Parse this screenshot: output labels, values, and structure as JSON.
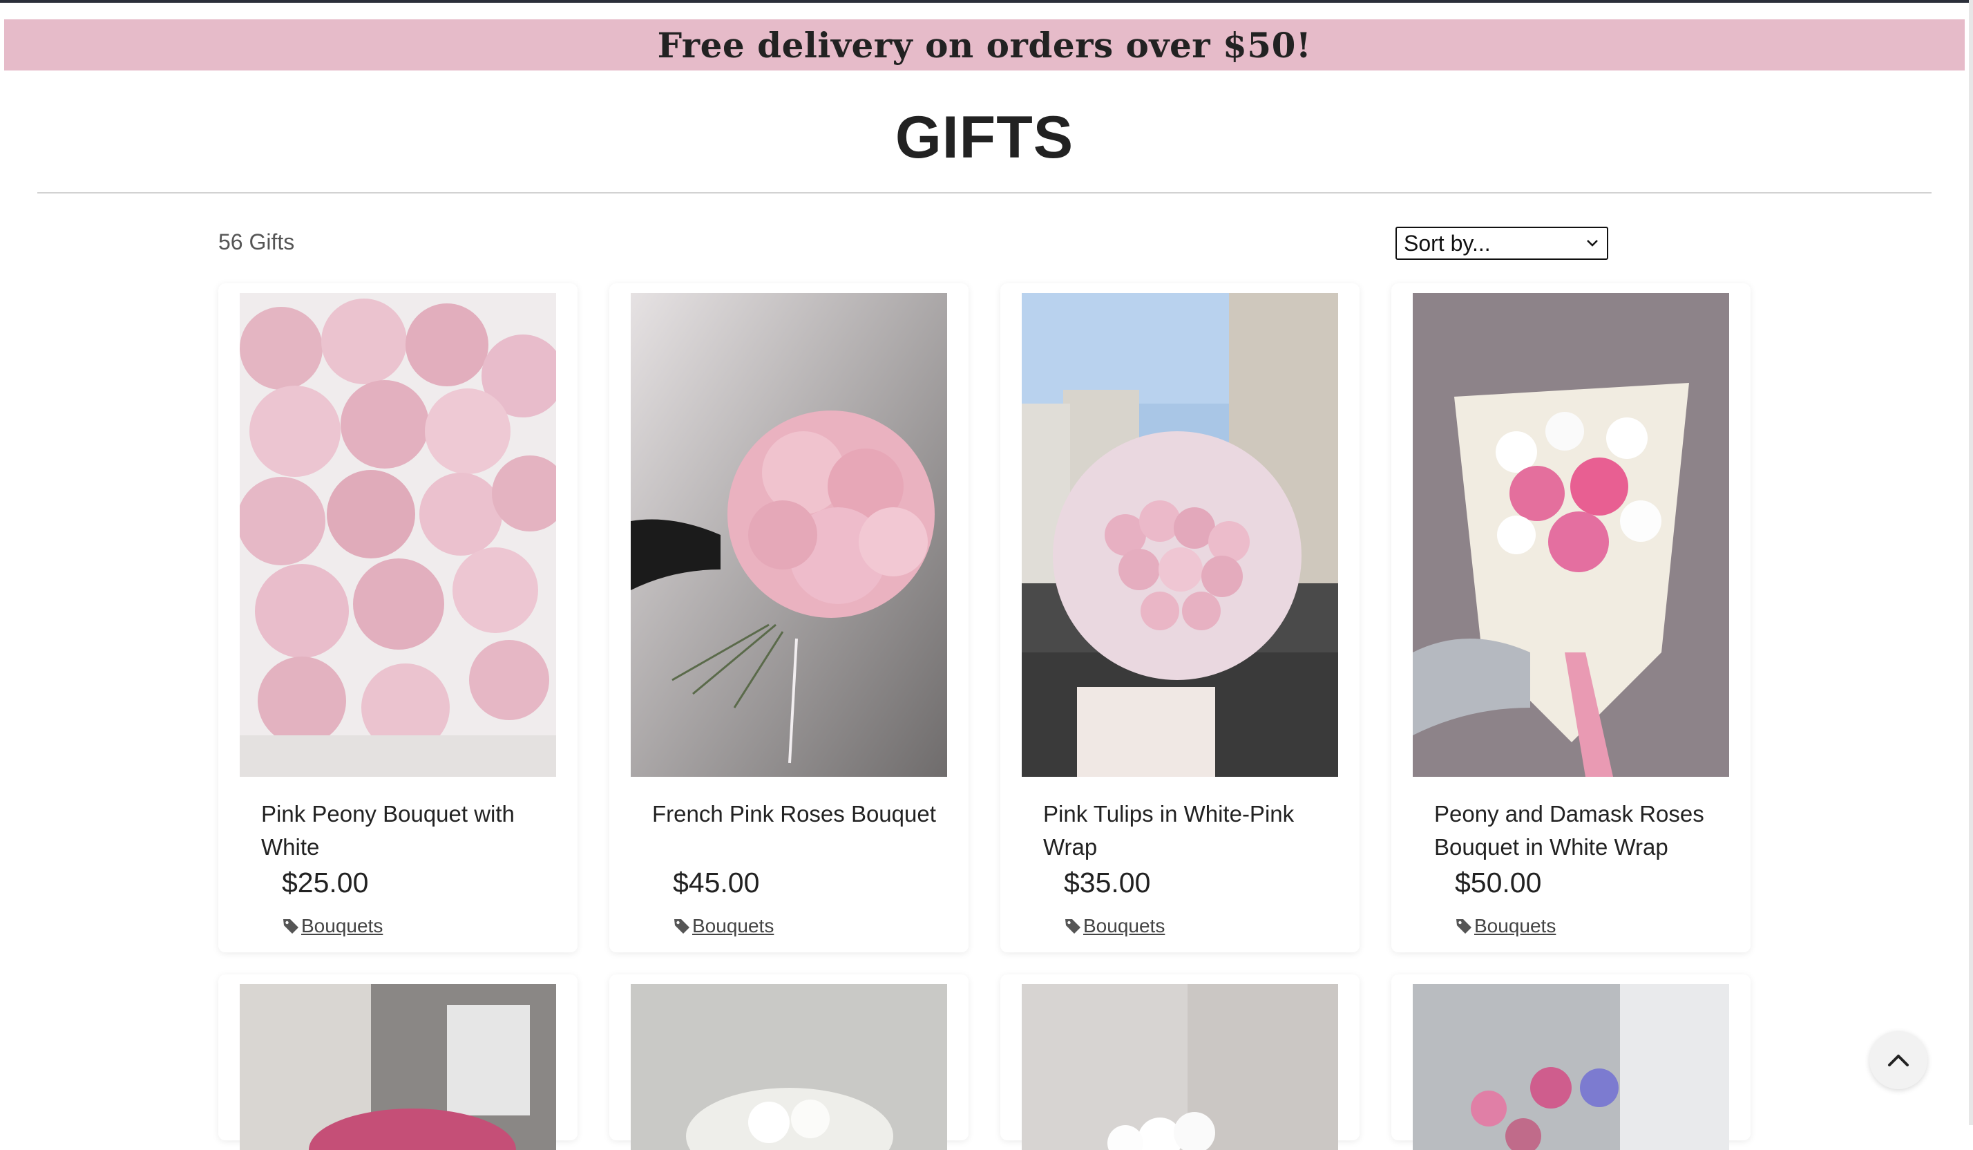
{
  "banner": {
    "text": "Free delivery on orders over $50!"
  },
  "page": {
    "title": "GIFTS",
    "count": "56 Gifts"
  },
  "sort": {
    "label": "Sort by..."
  },
  "products": [
    {
      "name": "Pink Peony Bouquet with White",
      "price": "$25.00",
      "category": "Bouquets"
    },
    {
      "name": "French Pink Roses Bouquet",
      "price": "$45.00",
      "category": "Bouquets"
    },
    {
      "name": "Pink Tulips in White-Pink Wrap",
      "price": "$35.00",
      "category": "Bouquets"
    },
    {
      "name": "Peony and Damask Roses Bouquet in White Wrap",
      "price": "$50.00",
      "category": "Bouquets"
    }
  ],
  "icons": {
    "tag": "tag-icon",
    "sort_chevron": "chevron-down-icon",
    "back_to_top": "chevron-up-icon"
  },
  "colors": {
    "banner": "#e6bbc9",
    "text": "#222222"
  }
}
